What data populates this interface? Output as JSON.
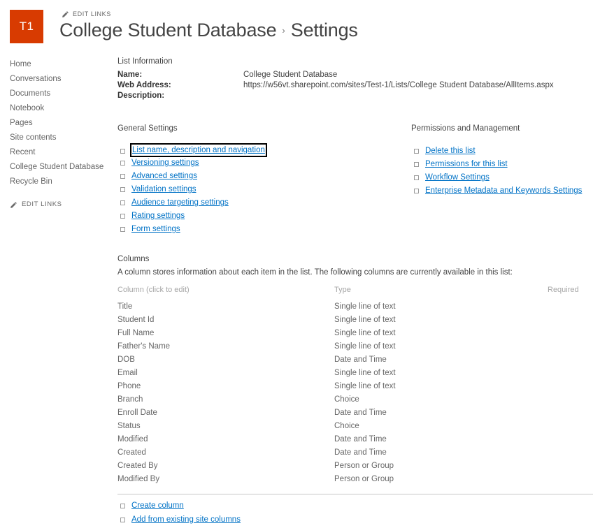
{
  "header": {
    "logo_text": "T1",
    "logo_color": "#d83b01",
    "edit_links_label": "EDIT LINKS",
    "site_title": "College Student Database",
    "title_separator": "›",
    "page_title": "Settings"
  },
  "sidebar": {
    "items": [
      {
        "label": "Home"
      },
      {
        "label": "Conversations"
      },
      {
        "label": "Documents"
      },
      {
        "label": "Notebook"
      },
      {
        "label": "Pages"
      },
      {
        "label": "Site contents"
      },
      {
        "label": "Recent"
      },
      {
        "label": "College Student Database"
      },
      {
        "label": "Recycle Bin"
      }
    ],
    "edit_links_label": "EDIT LINKS"
  },
  "list_information": {
    "heading": "List Information",
    "rows": [
      {
        "label": "Name:",
        "value": "College Student Database"
      },
      {
        "label": "Web Address:",
        "value": "https://w56vt.sharepoint.com/sites/Test-1/Lists/College Student Database/AllItems.aspx"
      },
      {
        "label": "Description:",
        "value": ""
      }
    ]
  },
  "general_settings": {
    "heading": "General Settings",
    "links": [
      {
        "label": "List name, description and navigation",
        "focused": true
      },
      {
        "label": "Versioning settings",
        "focused": false
      },
      {
        "label": "Advanced settings",
        "focused": false
      },
      {
        "label": "Validation settings",
        "focused": false
      },
      {
        "label": "Audience targeting settings",
        "focused": false
      },
      {
        "label": "Rating settings",
        "focused": false
      },
      {
        "label": "Form settings",
        "focused": false
      }
    ]
  },
  "permissions_and_management": {
    "heading": "Permissions and Management",
    "links": [
      {
        "label": "Delete this list"
      },
      {
        "label": "Permissions for this list"
      },
      {
        "label": "Workflow Settings"
      },
      {
        "label": "Enterprise Metadata and Keywords Settings"
      }
    ]
  },
  "columns": {
    "heading": "Columns",
    "description": "A column stores information about each item in the list. The following columns are currently available in this list:",
    "table_headers": [
      "Column (click to edit)",
      "Type",
      "Required"
    ],
    "rows": [
      {
        "name": "Title",
        "type": "Single line of text",
        "required": ""
      },
      {
        "name": "Student Id",
        "type": "Single line of text",
        "required": ""
      },
      {
        "name": "Full Name",
        "type": "Single line of text",
        "required": ""
      },
      {
        "name": "Father's Name",
        "type": "Single line of text",
        "required": ""
      },
      {
        "name": "DOB",
        "type": "Date and Time",
        "required": ""
      },
      {
        "name": "Email",
        "type": "Single line of text",
        "required": ""
      },
      {
        "name": "Phone",
        "type": "Single line of text",
        "required": ""
      },
      {
        "name": "Branch",
        "type": "Choice",
        "required": ""
      },
      {
        "name": "Enroll Date",
        "type": "Date and Time",
        "required": ""
      },
      {
        "name": "Status",
        "type": "Choice",
        "required": ""
      },
      {
        "name": "Modified",
        "type": "Date and Time",
        "required": ""
      },
      {
        "name": "Created",
        "type": "Date and Time",
        "required": ""
      },
      {
        "name": "Created By",
        "type": "Person or Group",
        "required": ""
      },
      {
        "name": "Modified By",
        "type": "Person or Group",
        "required": ""
      }
    ],
    "bottom_links": [
      {
        "label": "Create column"
      },
      {
        "label": "Add from existing site columns"
      }
    ]
  },
  "theme": {
    "link_color": "#0072c6",
    "text_color": "#666666",
    "accent": "#d83b01"
  }
}
